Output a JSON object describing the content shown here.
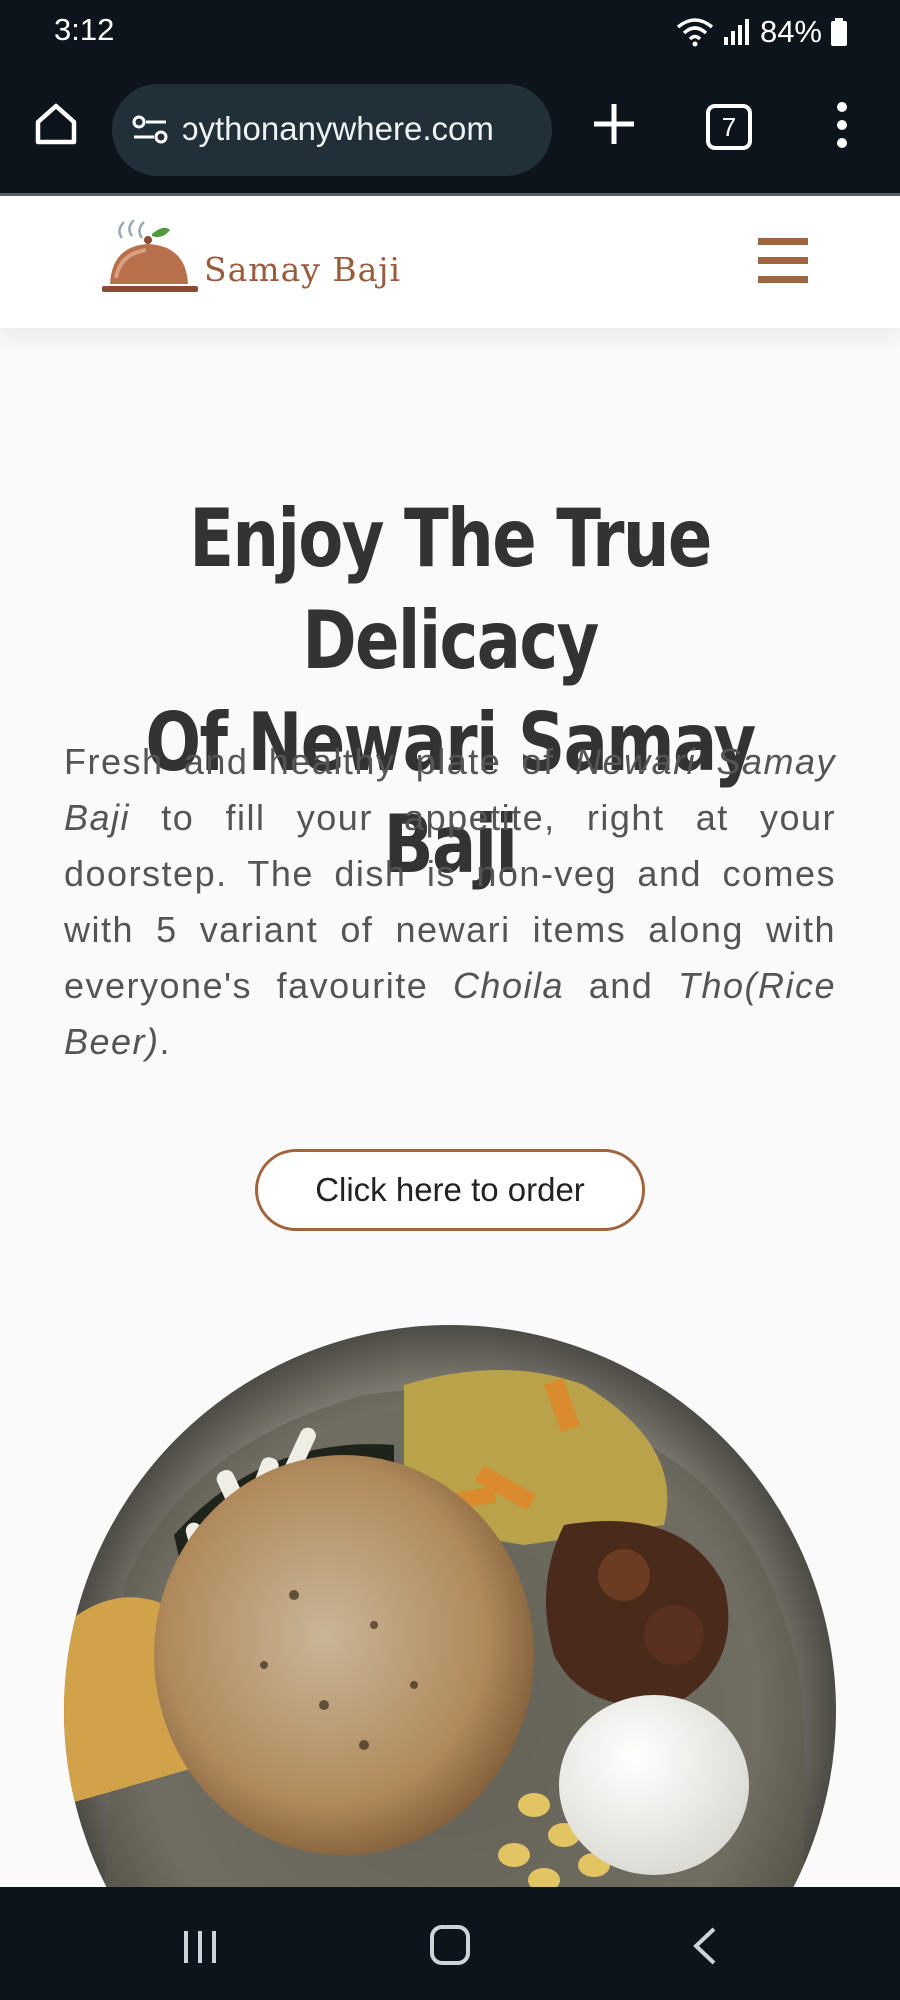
{
  "status_bar": {
    "time": "3:12",
    "battery": "84%",
    "icons": [
      "wifi-icon",
      "signal-icon",
      "battery-icon"
    ]
  },
  "browser": {
    "url": "ɔythonanywhere.com",
    "tab_count": "7",
    "icons": [
      "home-icon",
      "site-settings-icon",
      "new-tab-plus-icon",
      "tabs-icon",
      "more-options-icon"
    ]
  },
  "site_header": {
    "brand": "Samay Baji",
    "icons": [
      "cloche-logo-icon",
      "hamburger-menu-icon"
    ]
  },
  "hero": {
    "title_line1": "Enjoy The True Delicacy",
    "title_line2": "Of Newari Samay Baji",
    "desc_part1": "Fresh and healthy plate of ",
    "desc_em1": "Newari Samay Baji",
    "desc_part2": "  to fill your appetite, right at your doorstep. The dish is non-veg and comes with 5 variant of newari items along with everyone's favourite ",
    "desc_em2": "Choila",
    "desc_part3": " and ",
    "desc_em3": "Tho(Rice Beer)",
    "desc_part4": ".",
    "order_button": "Click here to order"
  },
  "colors": {
    "brand_brown": "#a0643f",
    "system_bar": "#0e141b",
    "url_pill": "#213038",
    "page_bg": "#fbfafa"
  },
  "nav_bar": {
    "icons": [
      "recent-apps-icon",
      "home-circle-icon",
      "back-icon"
    ]
  }
}
